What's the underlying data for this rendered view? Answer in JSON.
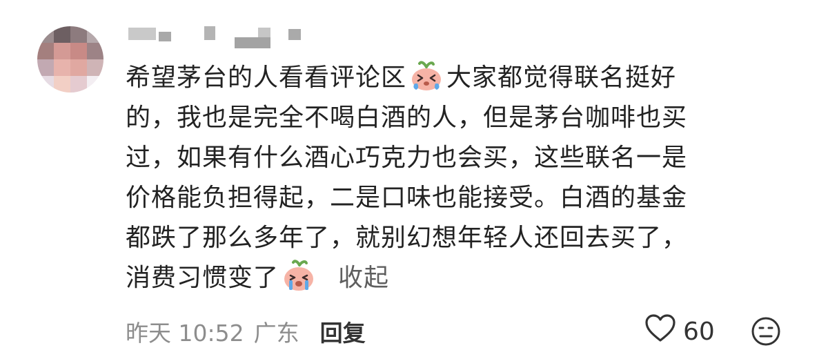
{
  "comment": {
    "lines": [
      "希望茅台的人看看评论区",
      "大家都觉得联名挺好",
      "的，我也是完全不喝白酒的人，但是茅台咖啡也买",
      "过，如果有什么酒心巧克力也会买，这些联名一是",
      "价格能负担得起，二是口味也能接受。白酒的基金",
      "都跌了那么多年了，就别幻想年轻人还回去买了，",
      "消费习惯变了"
    ],
    "inline_emoji": [
      "crying-face-sticker",
      "crying-face-sticker"
    ],
    "collapse_label": "收起"
  },
  "meta": {
    "time": "昨天 10:52",
    "location": "广东",
    "reply_label": "回复"
  },
  "actions": {
    "like_icon": "heart-icon",
    "like_count": "60",
    "dislike_icon": "meh-face-icon"
  },
  "colors": {
    "text": "#222222",
    "meta": "#8d8d8d",
    "emoji_face": "#f6b3a6",
    "leaf": "#6aa84f"
  }
}
